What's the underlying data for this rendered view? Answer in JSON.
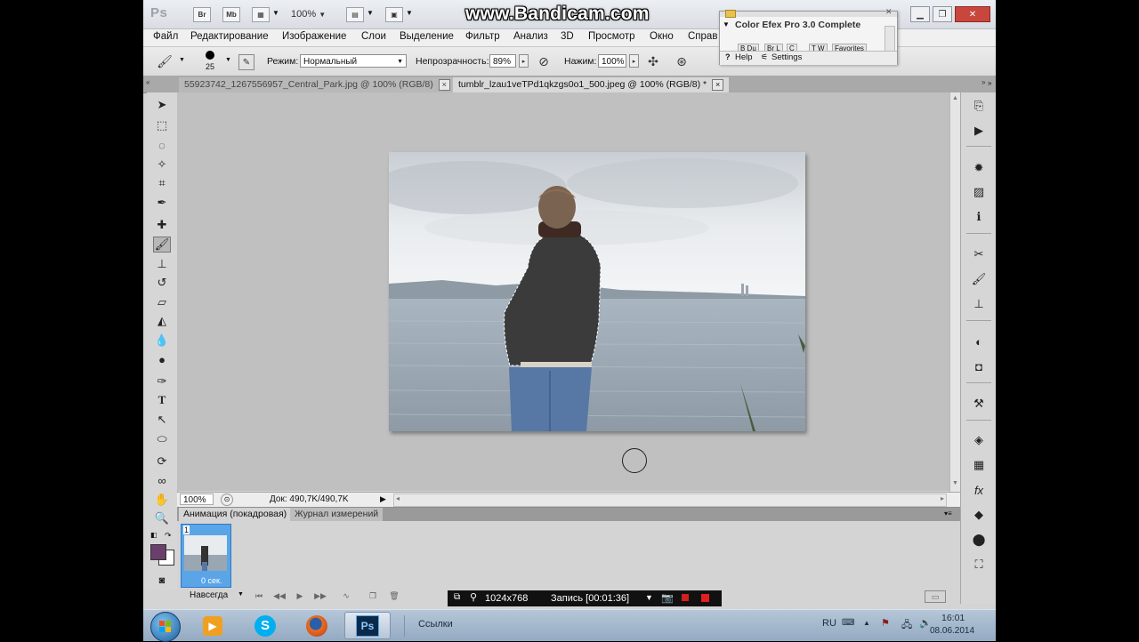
{
  "watermark": "www.Bandicam.com",
  "appbar": {
    "logo": "Ps",
    "bridge": "Br",
    "minibridge": "Mb",
    "zoom": "100%"
  },
  "menu": [
    "Файл",
    "Редактирование",
    "Изображение",
    "Слои",
    "Выделение",
    "Фильтр",
    "Анализ",
    "3D",
    "Просмотр",
    "Окно",
    "Справ"
  ],
  "options": {
    "brush_size": "25",
    "mode_label": "Режим:",
    "mode_value": "Нормальный",
    "opacity_label": "Непрозрачность:",
    "opacity_value": "89%",
    "pressure_label": "Нажим:",
    "pressure_value": "100%"
  },
  "doc_tabs": [
    {
      "label": "55923742_1267556957_Central_Park.jpg @ 100% (RGB/8)"
    },
    {
      "label": "tumblr_lzau1veTPd1qkzgs0o1_500.jpeg @ 100% (RGB/8) *"
    }
  ],
  "efex": {
    "title": "Color Efex Pro 3.0 Complete",
    "help": "Help",
    "settings": "Settings"
  },
  "status": {
    "zoom": "100%",
    "doc": "Док: 490,7K/490,7K"
  },
  "anim_panel": {
    "tab_active": "Анимация (покадровая)",
    "tab_other": "Журнал измерений",
    "frame_number": "1",
    "frame_delay": "0 сек.",
    "loop": "Навсегда"
  },
  "recbar": {
    "resolution": "1024x768",
    "record": "Запись [00:01:36]"
  },
  "taskbar": {
    "links": "Ссылки",
    "lang": "RU",
    "time": "16:01",
    "date": "08.06.2014"
  },
  "colors": {
    "foreground": "#6b3f6b",
    "background": "#ffffff",
    "frame_selected": "#5aa5e8"
  }
}
